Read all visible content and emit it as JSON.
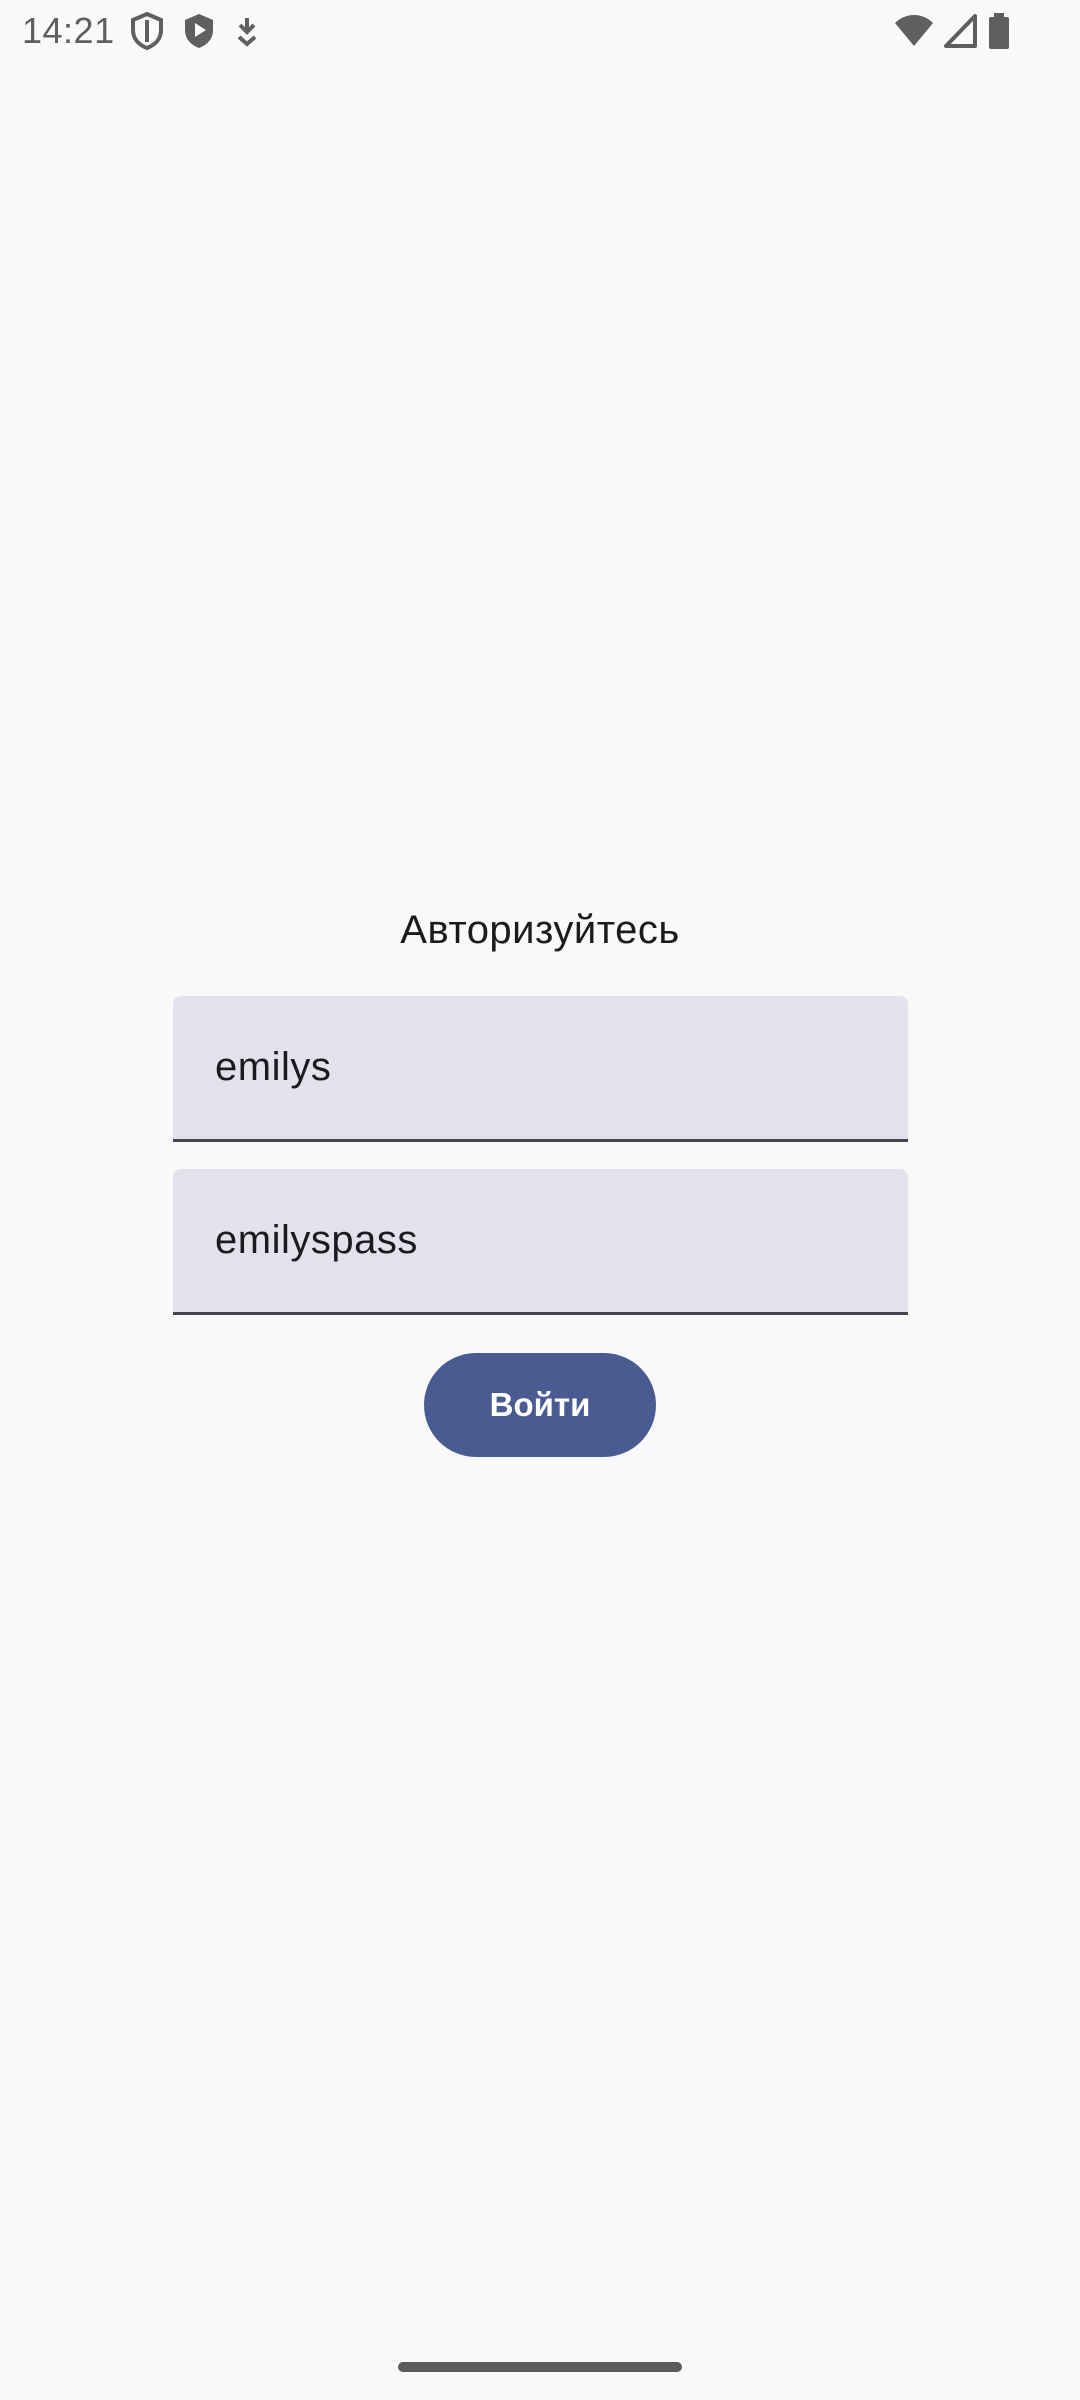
{
  "status_bar": {
    "time": "14:21",
    "left_icons": [
      "shield-outline-icon",
      "shield-play-icon",
      "download-arrow-icon"
    ],
    "right_icons": [
      "wifi-icon",
      "cellular-signal-icon",
      "battery-icon"
    ]
  },
  "login": {
    "title": "Авторизуйтесь",
    "username_value": "emilys",
    "password_value": "emilyspass",
    "submit_label": "Войти"
  },
  "colors": {
    "background": "#f9f9f9",
    "field_background": "#e2e2ec",
    "button_primary": "#4a5b92",
    "button_text": "#ffffff"
  }
}
